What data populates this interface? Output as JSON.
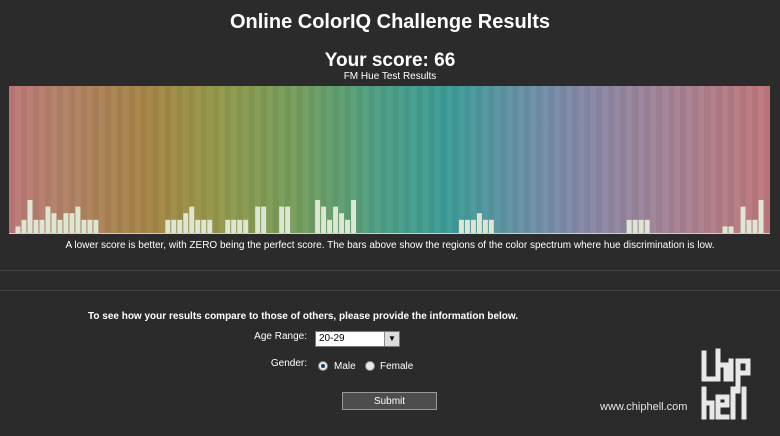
{
  "header": {
    "title": "Online ColorIQ Challenge Results",
    "score": "Your score: 66",
    "subtitle": "FM Hue Test Results"
  },
  "spectrum": {
    "bar_levels": [
      0,
      1,
      2,
      5,
      2,
      2,
      4,
      3,
      2,
      3,
      3,
      4,
      2,
      2,
      2,
      0,
      0,
      0,
      0,
      0,
      0,
      0,
      0,
      0,
      0,
      0,
      2,
      2,
      2,
      3,
      4,
      2,
      2,
      2,
      0,
      0,
      2,
      2,
      2,
      2,
      0,
      4,
      4,
      0,
      0,
      4,
      4,
      0,
      0,
      0,
      0,
      5,
      4,
      2,
      4,
      3,
      2,
      5,
      0,
      0,
      0,
      0,
      0,
      0,
      0,
      0,
      0,
      0,
      0,
      0,
      0,
      0,
      0,
      0,
      0,
      2,
      2,
      2,
      3,
      2,
      2,
      0,
      0,
      0,
      0,
      0,
      0,
      0,
      0,
      0,
      0,
      0,
      0,
      0,
      0,
      0,
      0,
      0,
      0,
      0,
      0,
      0,
      0,
      2,
      2,
      2,
      2,
      0,
      0,
      0,
      0,
      0,
      0,
      0,
      0,
      0,
      0,
      0,
      0,
      1,
      1,
      0,
      4,
      2,
      2,
      5,
      0
    ]
  },
  "caption": "A lower score is better, with ZERO being the perfect score. The bars above show the regions of the color spectrum where hue discrimination is low.",
  "form": {
    "intro": "To see how your results compare to those of others, please provide the information below.",
    "age_label": "Age Range:",
    "age_value": "20-29",
    "gender_label": "Gender:",
    "gender_options": [
      "Male",
      "Female"
    ],
    "gender_selected": "Male",
    "submit_label": "Submit"
  },
  "watermark": {
    "text": "www.chiphell.com",
    "logo_text": "chip hell"
  }
}
